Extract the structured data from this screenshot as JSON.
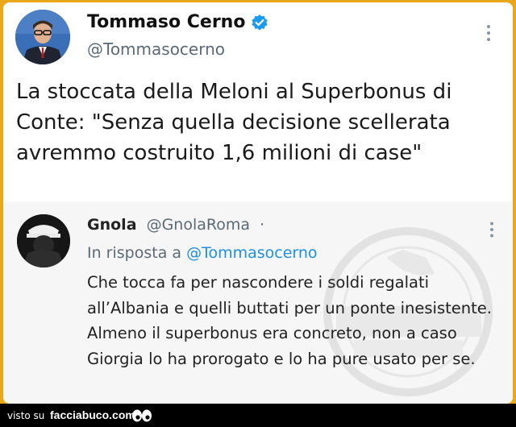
{
  "tweet": {
    "author_name": "Tommaso Cerno",
    "author_handle": "@Tommasocerno",
    "verified": true,
    "text": "La stoccata della Meloni al Superbonus di Conte: \"Senza quella decisione scellerata avremmo costruito 1,6 milioni di case\""
  },
  "reply": {
    "author_name": "Gnola",
    "author_handle": "@GnolaRoma",
    "separator": "·",
    "in_reply_prefix": "In risposta a",
    "in_reply_mention": "@Tommasocerno",
    "text": "Che tocca fa per nascondere i soldi regalati all’Albania e quelli buttati per un ponte inesistente. Almeno il superbonus era concreto, non a caso Giorgia  lo ha prorogato e lo ha pure usato per se.",
    "watermark_text": [
      "SARCASMO",
      "MILITANTE"
    ]
  },
  "footer": {
    "prefix": "visto su",
    "site": "facciabuco.com"
  },
  "colors": {
    "border": "#e8a81a",
    "mention": "#1d8fe6",
    "verified": "#1d9bf0"
  }
}
